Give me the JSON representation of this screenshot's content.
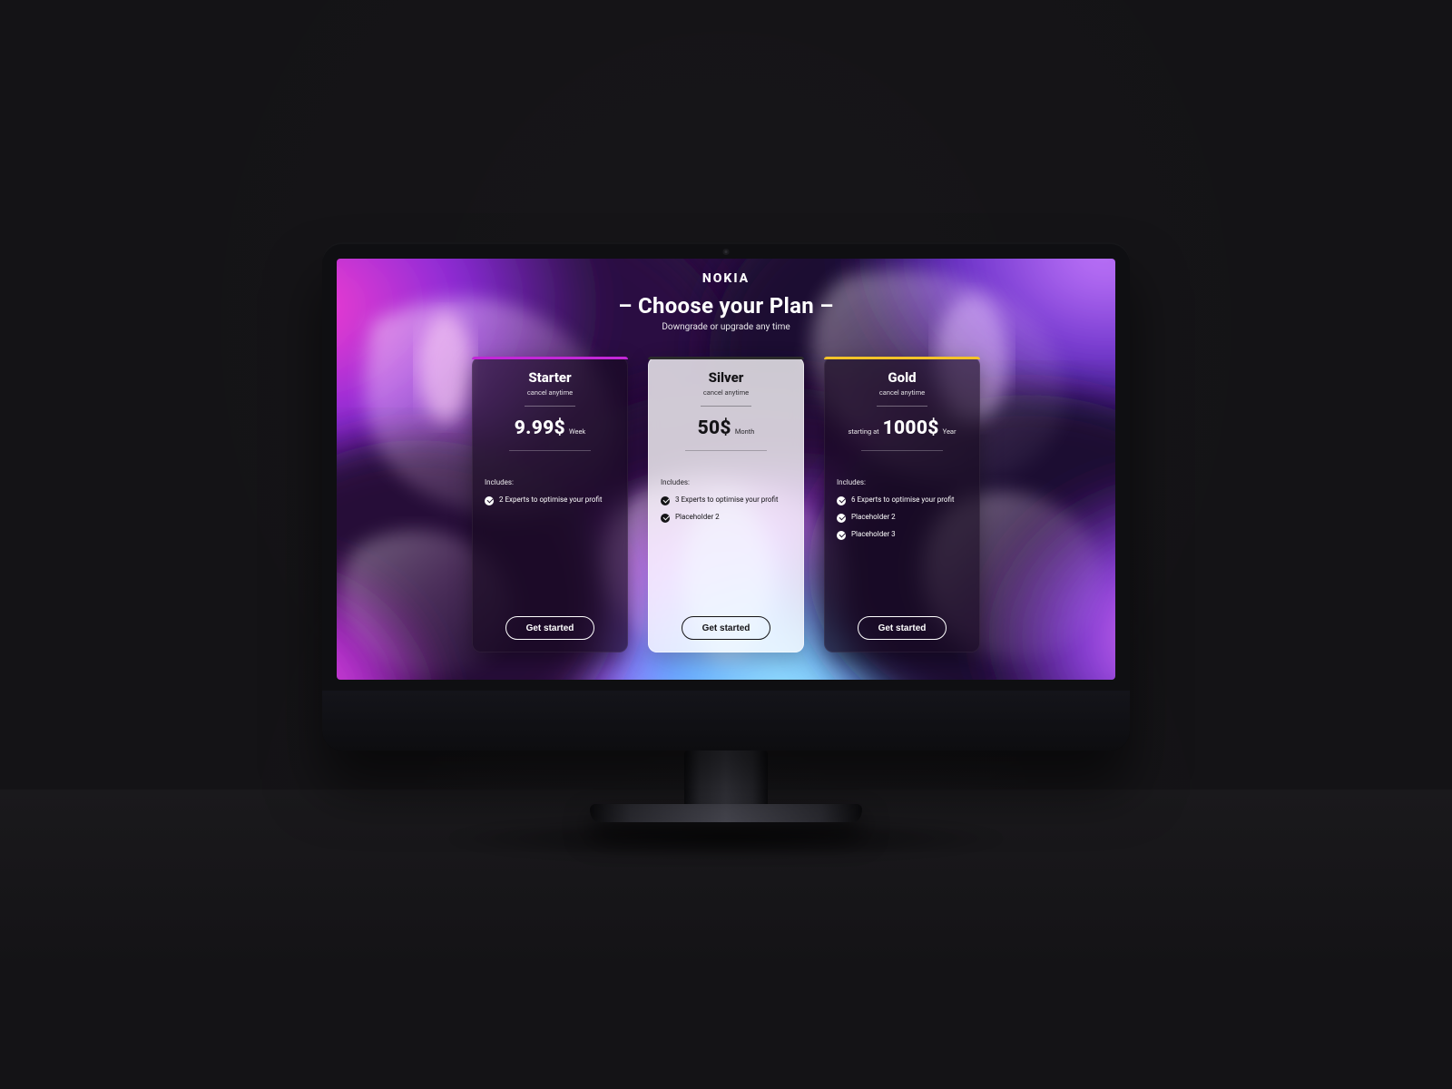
{
  "colors": {
    "starter_accent": "#c327d8",
    "silver_accent": "#2b2b2b",
    "gold_accent": "#f5c329"
  },
  "header": {
    "brand": "NOKIA",
    "title": "– Choose your Plan –",
    "subtitle": "Downgrade or upgrade any time"
  },
  "plans": [
    {
      "id": "starter",
      "name": "Starter",
      "subtitle": "cancel anytime",
      "price_prefix": "",
      "price": "9.99$",
      "period": "Week",
      "includes_label": "Includes:",
      "features": [
        "2 Experts to optimise your profit"
      ],
      "cta": "Get started"
    },
    {
      "id": "silver",
      "name": "Silver",
      "subtitle": "cancel anytime",
      "price_prefix": "",
      "price": "50$",
      "period": "Month",
      "includes_label": "Includes:",
      "features": [
        "3 Experts to optimise your profit",
        "Placeholder 2"
      ],
      "cta": "Get started"
    },
    {
      "id": "gold",
      "name": "Gold",
      "subtitle": "cancel anytime",
      "price_prefix": "starting at",
      "price": "1000$",
      "period": "Year",
      "includes_label": "Includes:",
      "features": [
        "6 Experts to optimise your profit",
        "Placeholder 2",
        "Placeholder 3"
      ],
      "cta": "Get started"
    }
  ]
}
